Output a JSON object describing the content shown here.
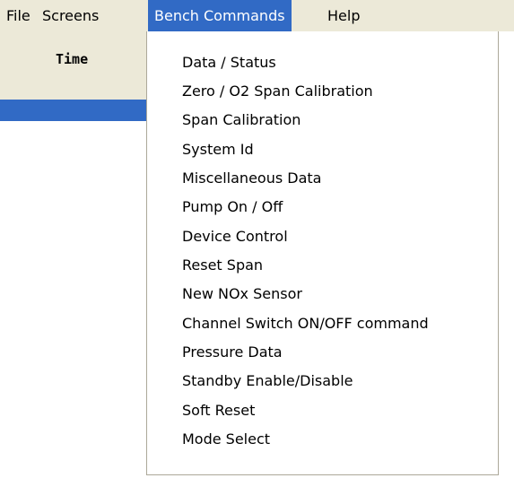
{
  "menubar": {
    "file": "File",
    "screens": "Screens",
    "bench_commands": "Bench Commands",
    "help": "Help"
  },
  "panel": {
    "time_label": "Time"
  },
  "dropdown": {
    "items": [
      "Data / Status",
      "Zero / O2 Span Calibration",
      "Span Calibration",
      "System Id",
      "Miscellaneous Data",
      "Pump On / Off",
      "Device Control",
      "Reset Span",
      "New NOx Sensor",
      "Channel Switch ON/OFF command",
      "Pressure Data",
      "Standby Enable/Disable",
      "Soft Reset",
      "Mode Select"
    ]
  },
  "colors": {
    "menubar_bg": "#ece9d8",
    "highlight": "#316ac5",
    "dropdown_bg": "#ffffff",
    "dropdown_border": "#aca899"
  }
}
